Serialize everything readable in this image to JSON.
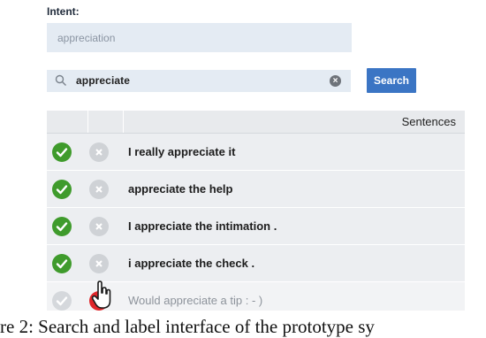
{
  "intent": {
    "label": "Intent:",
    "value": "appreciation"
  },
  "search": {
    "query": "appreciate",
    "button_label": "Search",
    "icon": "search-icon",
    "clear_icon": "clear-icon"
  },
  "table": {
    "column_header": "Sentences",
    "rows": [
      {
        "text": "I really appreciate it",
        "status": "accepted"
      },
      {
        "text": "appreciate the help",
        "status": "accepted"
      },
      {
        "text": "I appreciate the intimation .",
        "status": "accepted"
      },
      {
        "text": "i appreciate the check .",
        "status": "accepted"
      },
      {
        "text": "Would appreciate a tip : - )",
        "status": "being-rejected"
      }
    ]
  },
  "caption": "re 2: Search and label interface of the prototype sy",
  "colors": {
    "accept": "#3f9b2c",
    "reject_active": "#e0262a",
    "button": "#3b75c4",
    "field_bg": "#e4ebf3"
  }
}
